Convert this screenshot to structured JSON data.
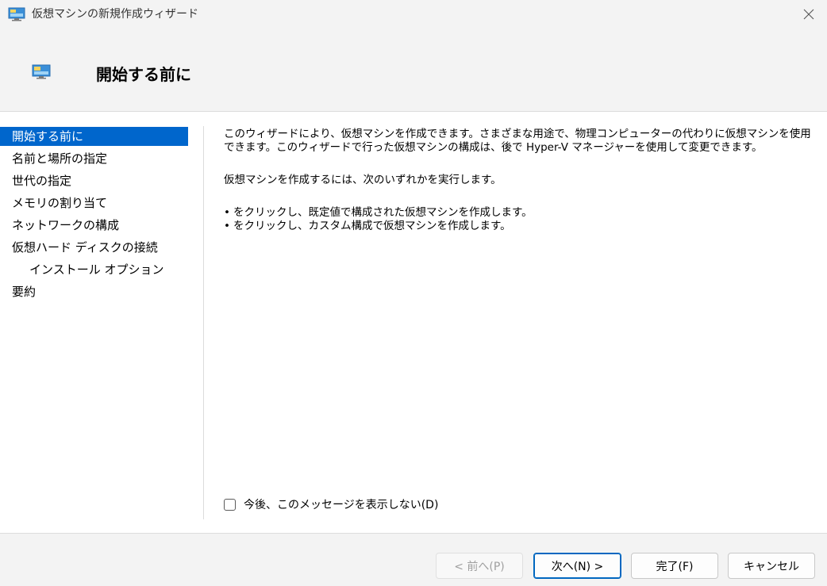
{
  "window": {
    "title": "仮想マシンの新規作成ウィザード",
    "icon": "monitor-icon"
  },
  "header": {
    "title": "開始する前に"
  },
  "sidebar": {
    "items": [
      {
        "label": "開始する前に",
        "active": true
      },
      {
        "label": "名前と場所の指定",
        "active": false
      },
      {
        "label": "世代の指定",
        "active": false
      },
      {
        "label": "メモリの割り当て",
        "active": false
      },
      {
        "label": "ネットワークの構成",
        "active": false
      },
      {
        "label": "仮想ハード ディスクの接続",
        "active": false
      },
      {
        "label": "インストール オプション",
        "active": false,
        "sub": true
      },
      {
        "label": "要約",
        "active": false
      }
    ]
  },
  "content": {
    "paragraph1": "このウィザードにより、仮想マシンを作成できます。さまざまな用途で、物理コンピューターの代わりに仮想マシンを使用できます。このウィザードで行った仮想マシンの構成は、後で Hyper-V マネージャーを使用して変更できます。",
    "paragraph2": "仮想マシンを作成するには、次のいずれかを実行します。",
    "bullets": [
      "をクリックし、既定値で構成された仮想マシンを作成します。",
      "をクリックし、カスタム構成で仮想マシンを作成します。"
    ],
    "checkbox_label": "今後、このメッセージを表示しない(D)",
    "checkbox_checked": false
  },
  "buttons": {
    "prev": "< 前へ(P)",
    "next": "次へ(N) >",
    "finish": "完了(F)",
    "cancel": "キャンセル"
  },
  "colors": {
    "accent": "#0066cc",
    "chrome": "#f3f3f3"
  }
}
